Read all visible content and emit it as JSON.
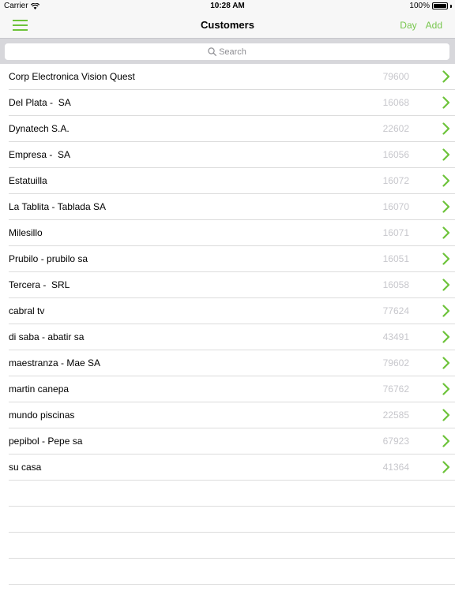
{
  "status_bar": {
    "carrier": "Carrier",
    "time": "10:28 AM",
    "battery": "100%"
  },
  "nav": {
    "title": "Customers",
    "actions": [
      "Day",
      "Add"
    ]
  },
  "search": {
    "placeholder": "Search"
  },
  "customers": [
    {
      "name": "Corp Electronica Vision Quest",
      "code": "79600"
    },
    {
      "name": "Del Plata -  SA",
      "code": "16068"
    },
    {
      "name": "Dynatech S.A.",
      "code": "22602"
    },
    {
      "name": "Empresa -  SA",
      "code": "16056"
    },
    {
      "name": "Estatuilla",
      "code": "16072"
    },
    {
      "name": "La Tablita - Tablada SA",
      "code": "16070"
    },
    {
      "name": "Milesillo",
      "code": "16071"
    },
    {
      "name": "Prubilo - prubilo sa",
      "code": "16051"
    },
    {
      "name": "Tercera -  SRL",
      "code": "16058"
    },
    {
      "name": "cabral tv",
      "code": "77624"
    },
    {
      "name": "di saba - abatir sa",
      "code": "43491"
    },
    {
      "name": "maestranza - Mae SA",
      "code": "79602"
    },
    {
      "name": "martin canepa",
      "code": "76762"
    },
    {
      "name": "mundo piscinas",
      "code": "22585"
    },
    {
      "name": "pepibol - Pepe sa",
      "code": "67923"
    },
    {
      "name": "su casa",
      "code": "41364"
    }
  ],
  "colors": {
    "accent": "#6dc33a",
    "nav_background": "#f7f7f7",
    "search_background": "#d7d7db",
    "code_text": "#c7c7cc",
    "separator": "#dcdcdc"
  },
  "icons": {
    "menu": "hamburger-menu-icon",
    "search": "magnifier-icon",
    "row": "chevron-right-icon",
    "wifi": "wifi-icon",
    "battery": "battery-icon"
  }
}
